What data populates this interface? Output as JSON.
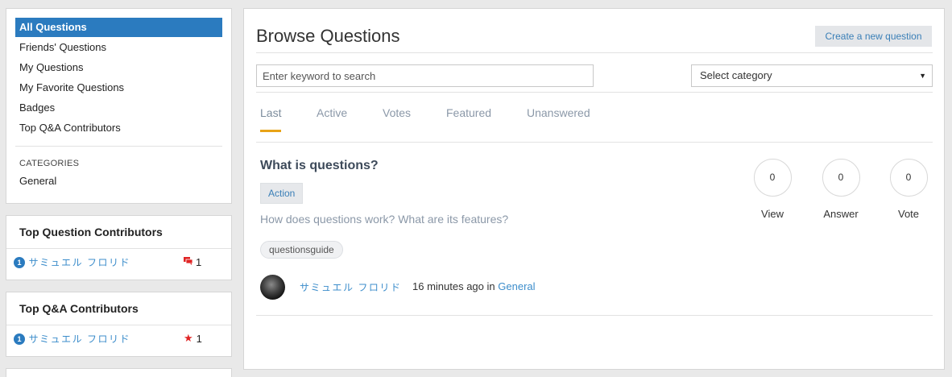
{
  "nav": {
    "items": [
      {
        "label": "All Questions",
        "active": true
      },
      {
        "label": "Friends' Questions"
      },
      {
        "label": "My Questions"
      },
      {
        "label": "My Favorite Questions"
      },
      {
        "label": "Badges"
      },
      {
        "label": "Top Q&A Contributors"
      }
    ],
    "categories_heading": "CATEGORIES",
    "categories": [
      "General"
    ]
  },
  "top_question_contributors": {
    "title": "Top Question Contributors",
    "rows": [
      {
        "rank": "1",
        "name": "サミュエル フロリド",
        "count": "1",
        "icon": "chat-icon"
      }
    ]
  },
  "top_qa_contributors": {
    "title": "Top Q&A Contributors",
    "rows": [
      {
        "rank": "1",
        "name": "サミュエル フロリド",
        "count": "1",
        "icon": "star-icon"
      }
    ]
  },
  "main": {
    "title": "Browse Questions",
    "create_button": "Create a new question",
    "search_placeholder": "Enter keyword to search",
    "category_select": "Select category",
    "tabs": [
      {
        "label": "Last",
        "active": true
      },
      {
        "label": "Active"
      },
      {
        "label": "Votes"
      },
      {
        "label": "Featured"
      },
      {
        "label": "Unanswered"
      }
    ],
    "question": {
      "title": "What is questions?",
      "badge": "Action",
      "description": "How does questions work? What are its features?",
      "tag": "questionsguide",
      "stats": [
        {
          "value": "0",
          "label": "View"
        },
        {
          "value": "0",
          "label": "Answer"
        },
        {
          "value": "0",
          "label": "Vote"
        }
      ],
      "author": "サミュエル フロリド",
      "time": "16 minutes ago",
      "in_word": "in",
      "category": "General"
    }
  },
  "colors": {
    "accent_blue": "#2b7bbf",
    "tab_underline": "#e8a317",
    "icon_red": "#e02424"
  }
}
